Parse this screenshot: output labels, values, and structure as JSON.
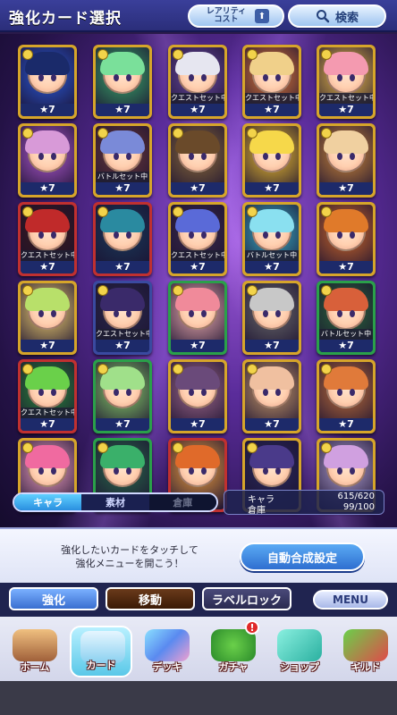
{
  "header": {
    "title": "強化カード選択",
    "rarity_cost_label": "レアリティ\nコスト",
    "search_label": "検索"
  },
  "cards": [
    {
      "row": 0,
      "col": 0,
      "star": "★7",
      "quest": "",
      "frame": "#d6a52a",
      "bg": "#2a5ad8",
      "hair": "#1a2a6a"
    },
    {
      "row": 0,
      "col": 1,
      "star": "★7",
      "quest": "",
      "frame": "#d6a52a",
      "bg": "#3aa86a",
      "hair": "#7ae09a"
    },
    {
      "row": 0,
      "col": 2,
      "star": "★7",
      "quest": "クエストセット中",
      "frame": "#d6a52a",
      "bg": "#6a4aa0",
      "hair": "#e6e6f0"
    },
    {
      "row": 0,
      "col": 3,
      "star": "★7",
      "quest": "クエストセット中",
      "frame": "#d6a52a",
      "bg": "#e07a3a",
      "hair": "#f0d08a"
    },
    {
      "row": 0,
      "col": 4,
      "star": "★7",
      "quest": "クエストセット中",
      "frame": "#d6a52a",
      "bg": "#f0c04a",
      "hair": "#f49ab0"
    },
    {
      "row": 1,
      "col": 0,
      "star": "★7",
      "quest": "",
      "frame": "#d6a52a",
      "bg": "#b05ad0",
      "hair": "#d89ad8"
    },
    {
      "row": 1,
      "col": 1,
      "star": "★7",
      "quest": "バトルセット中",
      "frame": "#d6a52a",
      "bg": "#6a3a3a",
      "hair": "#7a8ad8"
    },
    {
      "row": 1,
      "col": 2,
      "star": "★7",
      "quest": "",
      "frame": "#d6a52a",
      "bg": "#8a6a3a",
      "hair": "#6a4a2a"
    },
    {
      "row": 1,
      "col": 3,
      "star": "★7",
      "quest": "",
      "frame": "#d6a52a",
      "bg": "#f0c030",
      "hair": "#f6d84a"
    },
    {
      "row": 1,
      "col": 4,
      "star": "★7",
      "quest": "",
      "frame": "#d6a52a",
      "bg": "#d08a3a",
      "hair": "#f0d0a0"
    },
    {
      "row": 2,
      "col": 0,
      "star": "★7",
      "quest": "クエストセット中",
      "frame": "#c03030",
      "bg": "#3a1a1a",
      "hair": "#c02a2a"
    },
    {
      "row": 2,
      "col": 1,
      "star": "★7",
      "quest": "",
      "frame": "#c03030",
      "bg": "#1a3a5a",
      "hair": "#2a8aa0"
    },
    {
      "row": 2,
      "col": 2,
      "star": "★7",
      "quest": "クエストセット中",
      "frame": "#d6a52a",
      "bg": "#3a2a4a",
      "hair": "#5a6ad8"
    },
    {
      "row": 2,
      "col": 3,
      "star": "★7",
      "quest": "バトルセット中",
      "frame": "#d6a52a",
      "bg": "#3ab0c8",
      "hair": "#8ae0f0"
    },
    {
      "row": 2,
      "col": 4,
      "star": "★7",
      "quest": "",
      "frame": "#d6a52a",
      "bg": "#d06a2a",
      "hair": "#e07a2a"
    },
    {
      "row": 3,
      "col": 0,
      "star": "★7",
      "quest": "",
      "frame": "#d6a52a",
      "bg": "#f0d070",
      "hair": "#b8e06a"
    },
    {
      "row": 3,
      "col": 1,
      "star": "★7",
      "quest": "クエストセット中",
      "frame": "#3a4aa0",
      "bg": "#2a2a4a",
      "hair": "#3a2a6a"
    },
    {
      "row": 3,
      "col": 2,
      "star": "★7",
      "quest": "",
      "frame": "#2aa04a",
      "bg": "#f0b0b0",
      "hair": "#f08a9a"
    },
    {
      "row": 3,
      "col": 3,
      "star": "★7",
      "quest": "",
      "frame": "#d6a52a",
      "bg": "#6a6a6a",
      "hair": "#c8c8c8"
    },
    {
      "row": 3,
      "col": 4,
      "star": "★7",
      "quest": "バトルセット中",
      "frame": "#2aa04a",
      "bg": "#2a6a3a",
      "hair": "#d8603a"
    },
    {
      "row": 4,
      "col": 0,
      "star": "★7",
      "quest": "クエストセット中",
      "frame": "#c03030",
      "bg": "#2a8a3a",
      "hair": "#6ad04a"
    },
    {
      "row": 4,
      "col": 1,
      "star": "★7",
      "quest": "",
      "frame": "#2aa04a",
      "bg": "#8ad06a",
      "hair": "#a0e08a"
    },
    {
      "row": 4,
      "col": 2,
      "star": "★7",
      "quest": "",
      "frame": "#d6a52a",
      "bg": "#a06a8a",
      "hair": "#6a4a7a"
    },
    {
      "row": 4,
      "col": 3,
      "star": "★7",
      "quest": "",
      "frame": "#d6a52a",
      "bg": "#c89a6a",
      "hair": "#f0c0a0"
    },
    {
      "row": 4,
      "col": 4,
      "star": "★7",
      "quest": "",
      "frame": "#d6a52a",
      "bg": "#c0703a",
      "hair": "#e07a3a"
    },
    {
      "row": 5,
      "col": 0,
      "star": "",
      "quest": "",
      "frame": "#d6a52a",
      "bg": "#f0a0c0",
      "hair": "#f06aa0"
    },
    {
      "row": 5,
      "col": 1,
      "star": "",
      "quest": "",
      "frame": "#2aa04a",
      "bg": "#2a6a4a",
      "hair": "#3ab06a"
    },
    {
      "row": 5,
      "col": 2,
      "star": "",
      "quest": "",
      "frame": "#c03030",
      "bg": "#f0a040",
      "hair": "#e06a2a"
    },
    {
      "row": 5,
      "col": 3,
      "star": "",
      "quest": "",
      "frame": "#d6a52a",
      "bg": "#2a2a5a",
      "hair": "#4a3a8a"
    },
    {
      "row": 5,
      "col": 4,
      "star": "",
      "quest": "",
      "frame": "#d6a52a",
      "bg": "#b0a0d0",
      "hair": "#d0a0e0"
    }
  ],
  "tabs": {
    "chara": "キャラ",
    "material": "素材",
    "storage": "倉庫"
  },
  "counts": {
    "chara_label": "キャラ",
    "chara_value": "615/620",
    "storage_label": "倉庫",
    "storage_value": "99/100"
  },
  "info": {
    "hint_line1": "強化したいカードをタッチして",
    "hint_line2": "強化メニューを開こう！",
    "auto_button": "自動合成設定"
  },
  "actions": {
    "strengthen": "強化",
    "move": "移動",
    "label_lock": "ラベルロック",
    "menu": "MENU"
  },
  "nav": {
    "home": "ホーム",
    "card": "カード",
    "deck": "デッキ",
    "gacha": "ガチャ",
    "shop": "ショップ",
    "guild": "ギルド",
    "gacha_alert": "!"
  }
}
